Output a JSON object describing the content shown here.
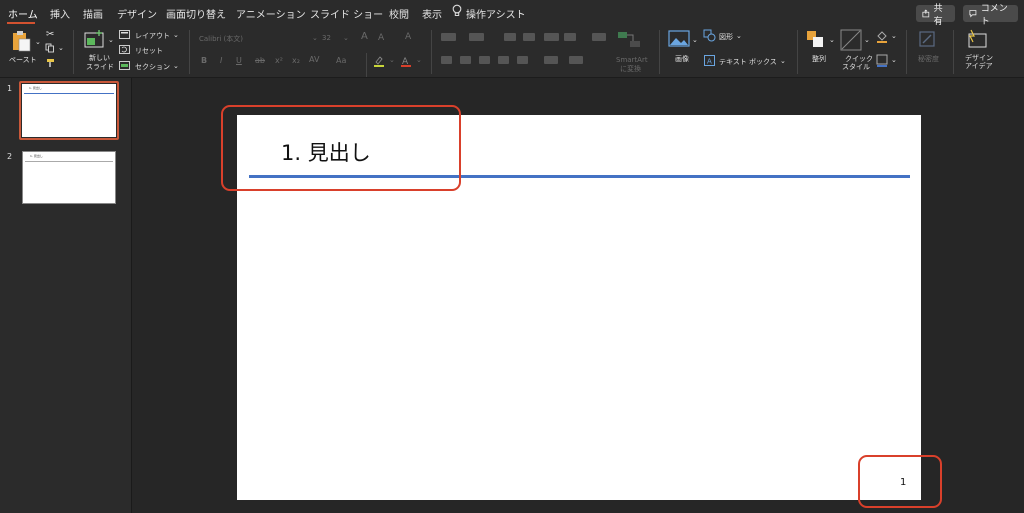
{
  "tabs": [
    "ホーム",
    "挿入",
    "描画",
    "デザイン",
    "画面切り替え",
    "アニメーション",
    "スライド ショー",
    "校閲",
    "表示",
    "操作アシスト"
  ],
  "share_label": "共有",
  "comment_label": "コメント",
  "ribbon": {
    "paste": "ペースト",
    "new_slide_line1": "新しい",
    "new_slide_line2": "スライド",
    "layout": "レイアウト",
    "reset": "リセット",
    "section": "セクション",
    "font_name": "Calibri (本文)",
    "font_size": "32",
    "smartart_line1": "SmartArt",
    "smartart_line2": "に変換",
    "picture": "画像",
    "shapes": "図形",
    "textbox": "テキスト ボックス",
    "arrange": "整列",
    "quick_styles_line1": "クイック",
    "quick_styles_line2": "スタイル",
    "sensitivity": "秘密度",
    "design_ideas_line1": "デザイン",
    "design_ideas_line2": "アイデア"
  },
  "thumbnails": [
    {
      "number": "1",
      "title": "1. 見出し",
      "selected": true
    },
    {
      "number": "2",
      "title": "1. 見出し",
      "selected": false
    }
  ],
  "slide": {
    "title": "1. 見出し",
    "page_number": "1"
  },
  "colors": {
    "accent": "#d35230",
    "rule": "#4472c4",
    "annotation": "#d9402b"
  }
}
